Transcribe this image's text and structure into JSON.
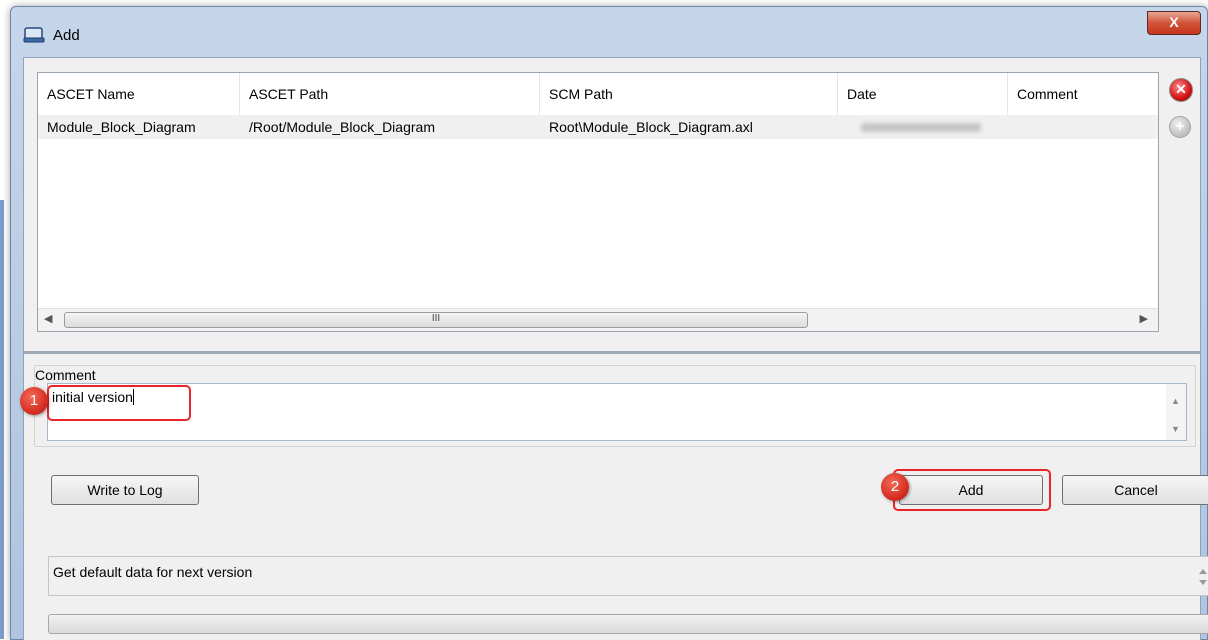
{
  "window": {
    "title": "Add",
    "close_glyph": "X"
  },
  "table": {
    "columns": [
      "ASCET Name",
      "ASCET Path",
      "SCM Path",
      "Date",
      "Comment"
    ],
    "rows": [
      {
        "ascet_name": "Module_Block_Diagram",
        "ascet_path": "/Root/Module_Block_Diagram",
        "scm_path": "Root\\Module_Block_Diagram.axl",
        "date": "",
        "comment": ""
      }
    ],
    "scroll_thumb_glyph": "III"
  },
  "side_buttons": {
    "remove_icon": "remove-icon",
    "add_icon": "add-item-icon"
  },
  "comment": {
    "label": "Comment",
    "value": "initial version"
  },
  "buttons": {
    "write_to_log": "Write to Log",
    "add": "Add",
    "cancel": "Cancel"
  },
  "badges": {
    "step1": "1",
    "step2": "2"
  },
  "status": {
    "text": "Get default data for next version"
  },
  "colors": {
    "highlight": "#e8262a",
    "remove": "#d11212",
    "title_bar": "#b7cbe3"
  }
}
